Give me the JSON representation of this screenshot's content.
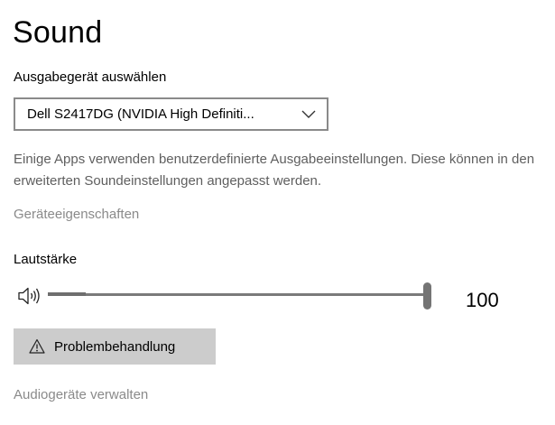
{
  "page": {
    "title": "Sound"
  },
  "output": {
    "label": "Ausgabegerät auswählen",
    "selected_device": "Dell S2417DG (NVIDIA High Definiti...",
    "chevron_icon": "chevron-down-icon",
    "description": "Einige Apps verwenden benutzerdefinierte Ausgabeeinstellungen. Diese können in den erweiterten Soundeinstellungen angepasst werden.",
    "device_properties_link": "Geräteeigenschaften"
  },
  "volume": {
    "label": "Lautstärke",
    "icon": "speaker-icon",
    "value": 100,
    "value_text": "100"
  },
  "troubleshoot": {
    "icon": "warning-icon",
    "label": "Problembehandlung"
  },
  "manage_link": "Audiogeräte verwalten",
  "colors": {
    "link_disabled": "#8a8a8a",
    "button_bg": "#cccccc",
    "slider": "#747474"
  }
}
